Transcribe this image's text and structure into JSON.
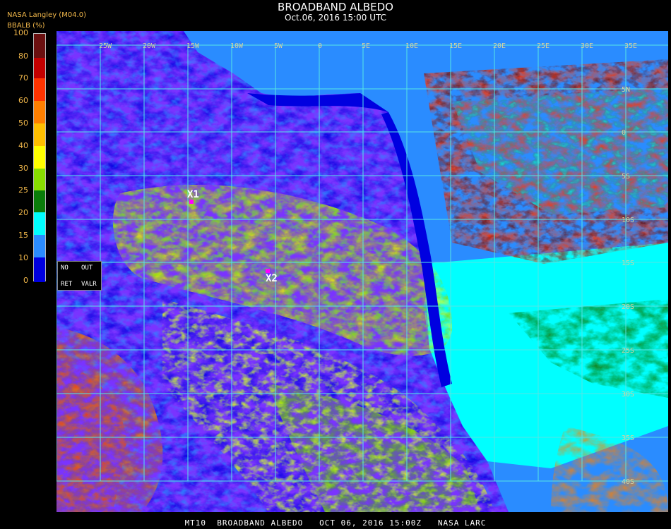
{
  "header": {
    "title": "BROADBAND ALBEDO",
    "subtitle": "Oct.06, 2016 15:00 UTC",
    "agency": "NASA Langley (M04.0)",
    "colorbar_label": "BBALB (%)"
  },
  "colorbar": {
    "ticks": [
      "100",
      "80",
      "70",
      "60",
      "50",
      "40",
      "30",
      "25",
      "20",
      "15",
      "10",
      "0"
    ],
    "colors": [
      "#6b1010",
      "#c40000",
      "#ff3300",
      "#ff7f00",
      "#ffbf00",
      "#ffff00",
      "#88dd00",
      "#0a7d0a",
      "#00ffff",
      "#2a8cff",
      "#0000e0",
      "#7a33ff"
    ]
  },
  "legend_box": {
    "no": "NO",
    "out": "OUT",
    "ret": "RET",
    "valr": "VALR"
  },
  "markers": [
    {
      "label": "X1",
      "color": "#ff00ff"
    },
    {
      "label": "X2",
      "color": "#ff00ff"
    }
  ],
  "grid": {
    "top_labels": [
      "25W",
      "20W",
      "15W",
      "10W",
      "5W",
      "0",
      "5E",
      "10E",
      "15E",
      "20E",
      "25E",
      "30E",
      "35E"
    ],
    "right_labels": [
      "5N",
      "0",
      "5S",
      "10S",
      "15S",
      "20S",
      "25S",
      "30S",
      "35S",
      "40S"
    ]
  },
  "footer": "MT10  BROADBAND ALBEDO   OCT 06, 2016 15:00Z   NASA LARC"
}
